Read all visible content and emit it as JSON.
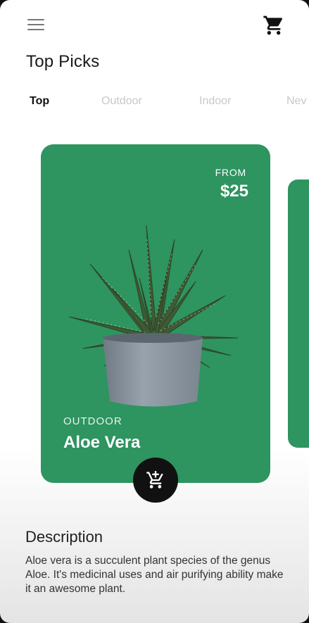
{
  "header": {
    "menu_icon": "hamburger-menu-icon",
    "cart_icon": "shopping-cart-icon",
    "title": "Top Picks"
  },
  "tabs": [
    {
      "label": "Top",
      "active": true
    },
    {
      "label": "Outdoor",
      "active": false
    },
    {
      "label": "Indoor",
      "active": false
    },
    {
      "label": "Nev",
      "active": false
    }
  ],
  "featured": {
    "price_prefix": "FROM",
    "price": "$25",
    "category": "OUTDOOR",
    "name": "Aloe Vera",
    "card_color": "#2e9460",
    "add_button_icon": "add-to-cart-icon"
  },
  "description": {
    "title": "Description",
    "text": "Aloe vera is a succulent plant species of the genus Aloe. It's medicinal uses and air purifying ability make it an awesome plant."
  }
}
